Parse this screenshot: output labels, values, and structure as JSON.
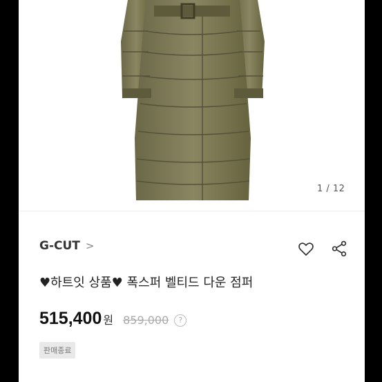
{
  "gallery": {
    "counter": "1 / 12",
    "image_icon": "olive-belted-long-down-coat"
  },
  "brand": {
    "name": "G-CUT",
    "chevron": ">"
  },
  "actions": {
    "wishlist_icon": "heart-outline-icon",
    "share_icon": "share-icon"
  },
  "product": {
    "title": "♥하트잇 상품♥ 폭스퍼 벨티드 다운 점퍼",
    "price": "515,400",
    "currency": "원",
    "original_price": "859,000",
    "help_label": "?",
    "status_badge": "판매종료"
  },
  "colors": {
    "coat": "#7a7654",
    "text": "#222222",
    "muted": "#aaaaaa"
  }
}
